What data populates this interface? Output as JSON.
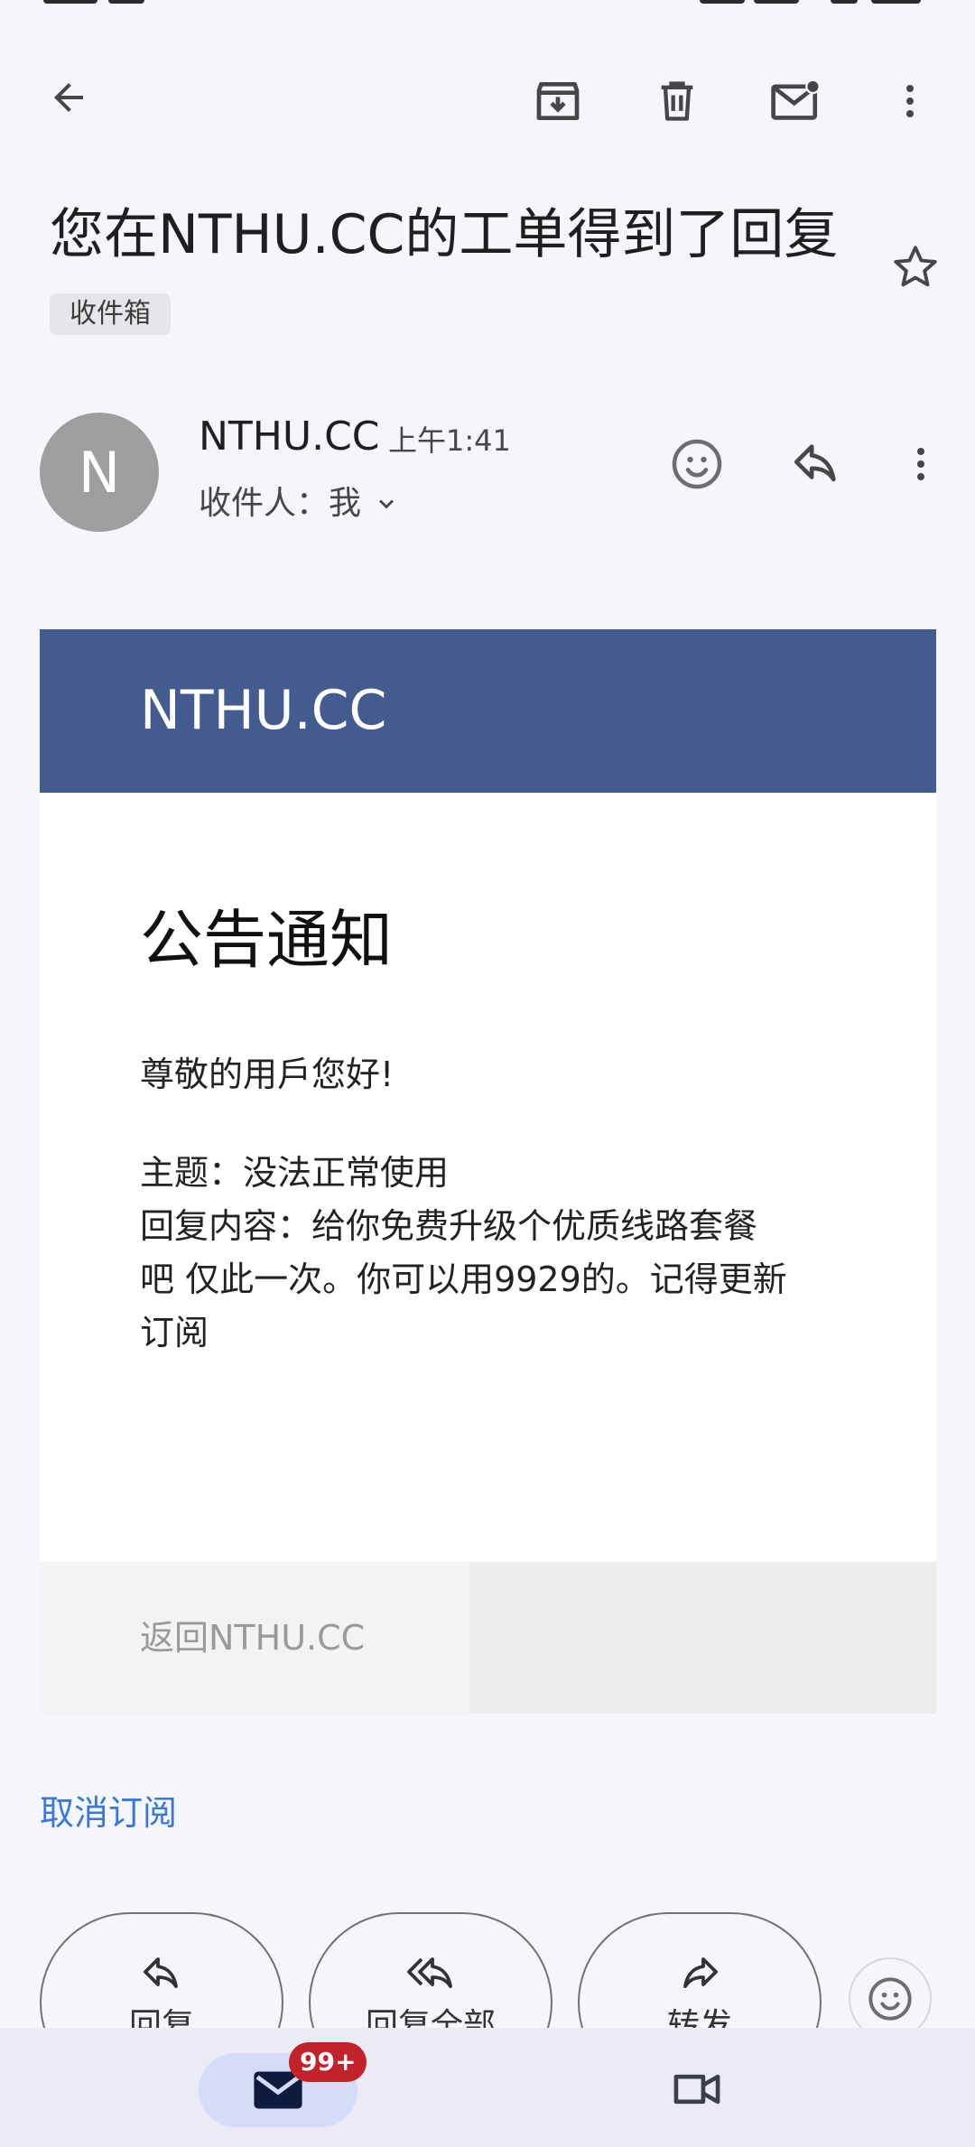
{
  "toolbar": {
    "back_icon": "arrow-back-icon",
    "archive_icon": "archive-icon",
    "delete_icon": "trash-icon",
    "mark_unread_icon": "mail-unread-icon",
    "more_icon": "more-vert-icon"
  },
  "email": {
    "subject": "您在NTHU.CC的工单得到了回复",
    "label": "收件箱",
    "starred": false,
    "sender": {
      "initial": "N",
      "name": "NTHU.CC",
      "time": "上午1:41",
      "recipient": "收件人：我"
    },
    "body": {
      "brand": "NTHU.CC",
      "title": "公告通知",
      "greeting": "尊敬的用戶您好!",
      "topic": "主题：没法正常使用",
      "reply_line1": "回复内容：给你免费升级个优质线路套餐",
      "reply_line2": "吧 仅此一次。你可以用9929的。记得更新",
      "reply_line3": "订阅",
      "back_link": "返回NTHU.CC"
    },
    "unsubscribe": "取消订阅"
  },
  "actions": {
    "reply": "回复",
    "reply_all": "回复全部",
    "forward": "转发"
  },
  "bottom_nav": {
    "mail_badge": "99+"
  },
  "colors": {
    "banner": "#435b8f",
    "link": "#3a78d8",
    "badge": "#c4222a",
    "avatar": "#9e9e9e"
  }
}
